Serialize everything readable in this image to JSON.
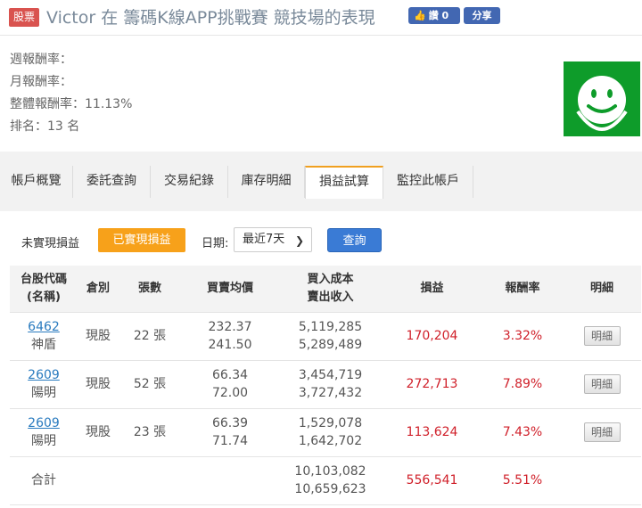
{
  "header": {
    "tag": "股票",
    "title": "Victor 在 籌碼K線APP挑戰賽 競技場的表現",
    "like_label": "讚 0",
    "share_label": "分享"
  },
  "summary": {
    "weekly": "週報酬率：",
    "monthly": "月報酬率：",
    "overall": "整體報酬率：11.13%",
    "rank": "排名：13 名"
  },
  "tabs": [
    {
      "label": "帳戶概覽"
    },
    {
      "label": "委託查詢"
    },
    {
      "label": "交易紀錄"
    },
    {
      "label": "庫存明細"
    },
    {
      "label": "損益試算"
    },
    {
      "label": "監控此帳戶"
    }
  ],
  "filter": {
    "unrealized_label": "未實現損益",
    "realized_label": "已實現損益",
    "date_label": "日期:",
    "date_value": "最近7天",
    "query_label": "查詢"
  },
  "table": {
    "headers": {
      "code_line1": "台股代碼",
      "code_line2": "(名稱)",
      "position": "倉別",
      "lots": "張數",
      "avg_price": "買賣均價",
      "cost_line1": "買入成本",
      "cost_line2": "賣出收入",
      "pnl": "損益",
      "return": "報酬率",
      "detail": "明細"
    },
    "rows": [
      {
        "code": "6462",
        "name": "神盾",
        "position": "現股",
        "lots": "22 張",
        "buy_price": "232.37",
        "sell_price": "241.50",
        "cost": "5,119,285",
        "revenue": "5,289,489",
        "pnl": "170,204",
        "return": "3.32%",
        "detail": "明細"
      },
      {
        "code": "2609",
        "name": "陽明",
        "position": "現股",
        "lots": "52 張",
        "buy_price": "66.34",
        "sell_price": "72.00",
        "cost": "3,454,719",
        "revenue": "3,727,432",
        "pnl": "272,713",
        "return": "7.89%",
        "detail": "明細"
      },
      {
        "code": "2609",
        "name": "陽明",
        "position": "現股",
        "lots": "23 張",
        "buy_price": "66.39",
        "sell_price": "71.74",
        "cost": "1,529,078",
        "revenue": "1,642,702",
        "pnl": "113,624",
        "return": "7.43%",
        "detail": "明細"
      }
    ],
    "total": {
      "label": "合計",
      "cost": "10,103,082",
      "revenue": "10,659,623",
      "pnl": "556,541",
      "return": "5.51%"
    }
  },
  "colors": {
    "accent_orange": "#f7a11a",
    "query_blue": "#3a7bd5",
    "profit_red": "#d0202a",
    "avatar_green": "#0e9c2a"
  }
}
